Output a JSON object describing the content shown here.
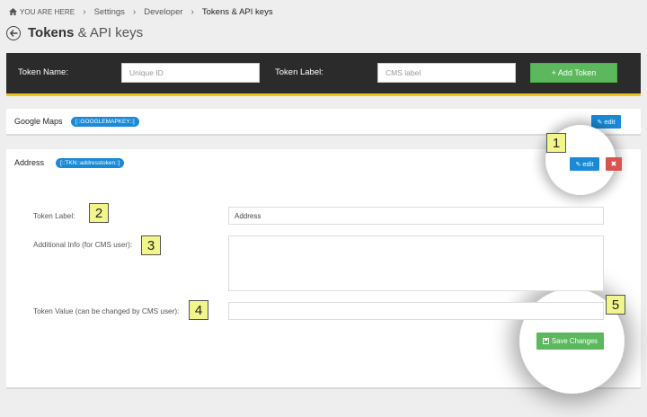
{
  "breadcrumb": {
    "root": "YOU ARE HERE",
    "items": [
      "Settings",
      "Developer",
      "Tokens & API keys"
    ],
    "separator": "›"
  },
  "header": {
    "title_bold": "Tokens",
    "title_rest": "& API keys"
  },
  "add_bar": {
    "token_name_label": "Token Name:",
    "token_name_placeholder": "Unique ID",
    "token_label_label": "Token Label:",
    "token_label_placeholder": "CMS label",
    "add_button_label": "+ Add Token"
  },
  "tokens": [
    {
      "name": "Google Maps",
      "badge": "[::GOOGLEMAPKEY::]",
      "edit_label": "edit"
    },
    {
      "name": "Address",
      "badge": "[::TKN::addresstoken::]",
      "edit_label": "edit",
      "delete_label": "✖",
      "form": {
        "token_label_label": "Token Label:",
        "token_label_value": "Address",
        "additional_info_label": "Additional Info (for CMS user):",
        "additional_info_value": "",
        "token_value_label": "Token Value (can be changed by CMS user):",
        "token_value_value": "",
        "save_label": "Save Changes"
      }
    }
  ],
  "callouts": [
    "1",
    "2",
    "3",
    "4",
    "5"
  ],
  "colors": {
    "bar_bg": "#2b2b2b",
    "bar_accent": "#f1c21b",
    "primary": "#1a8ad6",
    "success": "#5cb85c",
    "danger": "#d9534f",
    "callout_bg": "#f2f58a"
  }
}
